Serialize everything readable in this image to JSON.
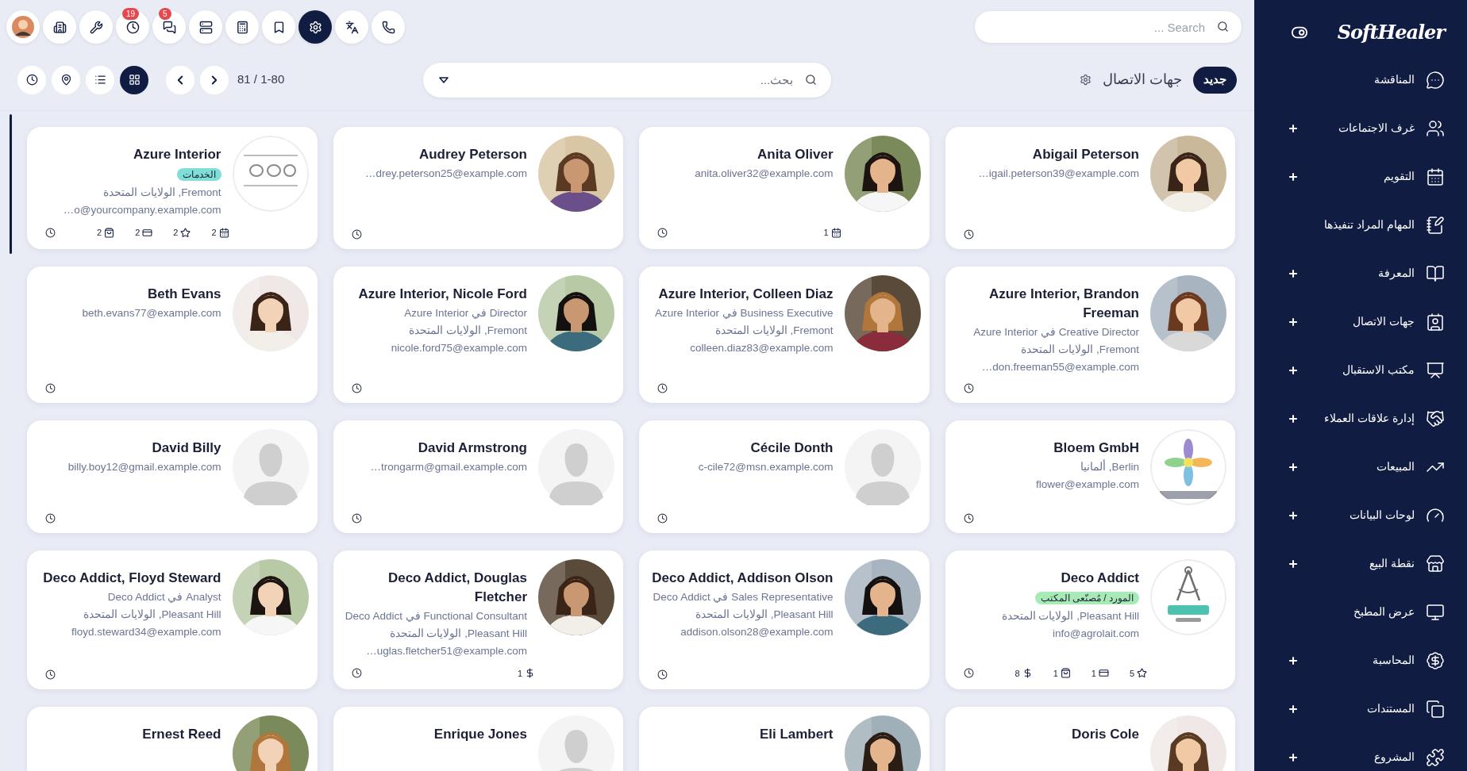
{
  "topbar": {
    "tray": [
      {
        "kind": "phone",
        "active": false
      },
      {
        "kind": "translate",
        "active": false
      },
      {
        "kind": "settings",
        "active": true
      },
      {
        "kind": "bookmark",
        "active": false
      },
      {
        "kind": "calculator",
        "active": false
      },
      {
        "kind": "server",
        "active": false
      },
      {
        "kind": "chat",
        "active": false,
        "badge": "5"
      },
      {
        "kind": "activity",
        "active": false,
        "badge": "19"
      },
      {
        "kind": "tools",
        "active": false
      },
      {
        "kind": "building",
        "active": false
      },
      {
        "kind": "avatar",
        "active": false
      }
    ],
    "search": {
      "placeholder": "Search ..."
    }
  },
  "control_panel": {
    "new_button": "جديد",
    "title": "جهات الاتصال",
    "search": {
      "placeholder": "بحث..."
    },
    "pager": "1-80 / 81",
    "views": [
      {
        "kind": "kanban",
        "selected": true
      },
      {
        "kind": "list",
        "selected": false
      },
      {
        "kind": "map",
        "selected": false
      },
      {
        "kind": "activity",
        "selected": false
      }
    ]
  },
  "cards": [
    {
      "name": "Abigail Peterson",
      "lines": [
        {
          "kind": "email",
          "text": "…igail.peterson39@example.com"
        }
      ]
    },
    {
      "name": "Anita Oliver",
      "lines": [
        {
          "kind": "email",
          "text": "anita.oliver32@example.com"
        }
      ],
      "counters": [
        {
          "kind": "calendar",
          "count": "1"
        }
      ]
    },
    {
      "name": "Audrey Peterson",
      "lines": [
        {
          "kind": "email",
          "text": "…drey.peterson25@example.com"
        }
      ]
    },
    {
      "name": "Azure Interior",
      "kind": "logo",
      "tag": {
        "text": "الخدمات",
        "color": "#7fded6"
      },
      "lines": [
        {
          "kind": "address",
          "text": "Fremont, الولايات المتحدة"
        },
        {
          "kind": "email",
          "text": "…o@yourcompany.example.com"
        }
      ],
      "counters": [
        {
          "kind": "calendar",
          "count": "2"
        },
        {
          "kind": "star",
          "count": "2"
        },
        {
          "kind": "card",
          "count": "2"
        },
        {
          "kind": "bag",
          "count": "2"
        }
      ]
    },
    {
      "name": "Azure Interior, Brandon Freeman",
      "lines": [
        {
          "kind": "job",
          "text": "Creative Director في Azure Interior"
        },
        {
          "kind": "address",
          "text": "Fremont, الولايات المتحدة"
        },
        {
          "kind": "email",
          "text": "…don.freeman55@example.com"
        }
      ]
    },
    {
      "name": "Azure Interior, Colleen Diaz",
      "lines": [
        {
          "kind": "job",
          "text": "Business Executive في Azure Interior"
        },
        {
          "kind": "address",
          "text": "Fremont, الولايات المتحدة"
        },
        {
          "kind": "email",
          "text": "colleen.diaz83@example.com"
        }
      ]
    },
    {
      "name": "Azure Interior, Nicole Ford",
      "lines": [
        {
          "kind": "job",
          "text": "Director في Azure Interior"
        },
        {
          "kind": "address",
          "text": "Fremont, الولايات المتحدة"
        },
        {
          "kind": "email",
          "text": "nicole.ford75@example.com"
        }
      ]
    },
    {
      "name": "Beth Evans",
      "lines": [
        {
          "kind": "email",
          "text": "beth.evans77@example.com"
        }
      ]
    },
    {
      "name": "Bloem GmbH",
      "kind": "logo",
      "lines": [
        {
          "kind": "address",
          "text": "Berlin, ألمانيا"
        },
        {
          "kind": "email",
          "text": "flower@example.com"
        }
      ]
    },
    {
      "name": "Cécile Donth",
      "kind": "placeholder",
      "lines": [
        {
          "kind": "email",
          "text": "c-cile72@msn.example.com"
        }
      ]
    },
    {
      "name": "David Armstrong",
      "kind": "placeholder",
      "lines": [
        {
          "kind": "email",
          "text": "…trongarm@gmail.example.com"
        }
      ]
    },
    {
      "name": "David Billy",
      "kind": "placeholder",
      "lines": [
        {
          "kind": "email",
          "text": "billy.boy12@gmail.example.com"
        }
      ]
    },
    {
      "name": "Deco Addict",
      "kind": "logo",
      "tag": {
        "text": "المورد / مُصنّعى المكتب",
        "color": "#a8eab5"
      },
      "lines": [
        {
          "kind": "address",
          "text": "Pleasant Hill, الولايات المتحدة"
        },
        {
          "kind": "email",
          "text": "info@agrolait.com"
        }
      ],
      "counters": [
        {
          "kind": "star",
          "count": "5"
        },
        {
          "kind": "card",
          "count": "1"
        },
        {
          "kind": "bag",
          "count": "1"
        },
        {
          "kind": "dollar",
          "count": "8"
        }
      ]
    },
    {
      "name": "Deco Addict, Addison Olson",
      "lines": [
        {
          "kind": "job",
          "text": "Sales Representative في Deco Addict"
        },
        {
          "kind": "address",
          "text": "Pleasant Hill, الولايات المتحدة"
        },
        {
          "kind": "email",
          "text": "addison.olson28@example.com"
        }
      ]
    },
    {
      "name": "Deco Addict, Douglas Fletcher",
      "lines": [
        {
          "kind": "job",
          "text": "Functional Consultant في Deco Addict"
        },
        {
          "kind": "address",
          "text": "Pleasant Hill, الولايات المتحدة"
        },
        {
          "kind": "email",
          "text": "…uglas.fletcher51@example.com"
        }
      ],
      "counters": [
        {
          "kind": "dollar",
          "count": "1"
        }
      ]
    },
    {
      "name": "Deco Addict, Floyd Steward",
      "lines": [
        {
          "kind": "job",
          "text": "Analyst في Deco Addict"
        },
        {
          "kind": "address",
          "text": "Pleasant Hill, الولايات المتحدة"
        },
        {
          "kind": "email",
          "text": "floyd.steward34@example.com"
        }
      ]
    },
    {
      "name": "Doris Cole"
    },
    {
      "name": "Eli Lambert"
    },
    {
      "name": "Enrique Jones",
      "kind": "placeholder"
    },
    {
      "name": "Ernest Reed"
    }
  ],
  "sidebar": {
    "brand": "SoftHealer",
    "items": [
      {
        "kind": "chat",
        "label": "المناقشة",
        "has_submenu": false
      },
      {
        "kind": "users",
        "label": "غرف الاجتماعات",
        "has_submenu": true
      },
      {
        "kind": "calendar",
        "label": "التقويم",
        "has_submenu": true
      },
      {
        "kind": "notes",
        "label": "المهام المراد تنفيذها",
        "has_submenu": false
      },
      {
        "kind": "book",
        "label": "المعرفة",
        "has_submenu": true
      },
      {
        "kind": "contact",
        "label": "جهات الاتصال",
        "has_submenu": true
      },
      {
        "kind": "desk",
        "label": "مكتب الاستقبال",
        "has_submenu": true
      },
      {
        "kind": "handshake",
        "label": "إدارة علاقات العملاء",
        "has_submenu": true
      },
      {
        "kind": "chart",
        "label": "المبيعات",
        "has_submenu": true
      },
      {
        "kind": "gauge",
        "label": "لوحات البيانات",
        "has_submenu": true
      },
      {
        "kind": "store",
        "label": "نقطة البيع",
        "has_submenu": true
      },
      {
        "kind": "monitor",
        "label": "عرض المطبخ",
        "has_submenu": false
      },
      {
        "kind": "money",
        "label": "المحاسبة",
        "has_submenu": true
      },
      {
        "kind": "copy",
        "label": "المستندات",
        "has_submenu": true
      },
      {
        "kind": "puzzle",
        "label": "المشروع",
        "has_submenu": true
      }
    ]
  }
}
